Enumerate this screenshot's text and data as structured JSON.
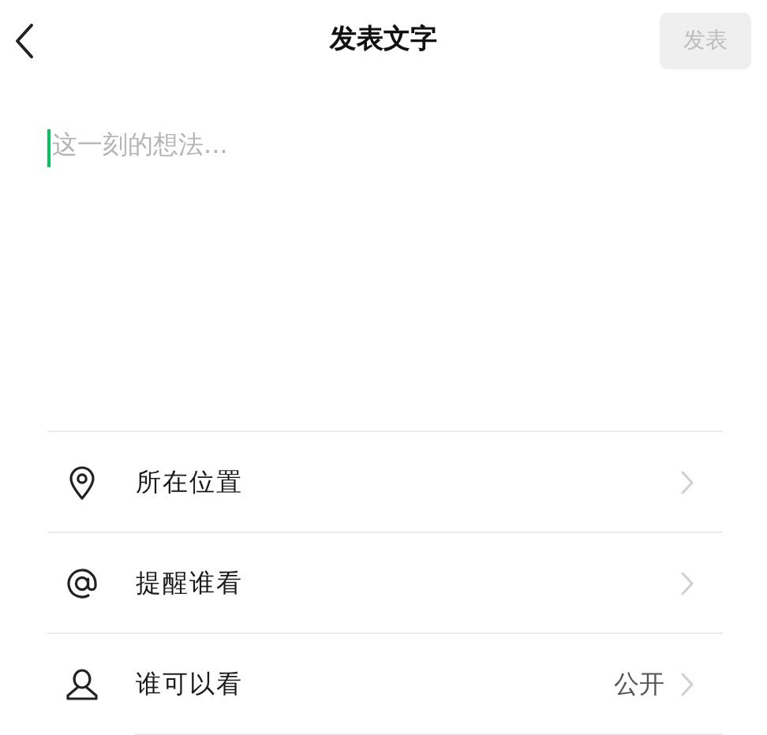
{
  "header": {
    "title": "发表文字",
    "post_button": {
      "label": "发表",
      "disabled": true
    }
  },
  "composer": {
    "placeholder": "这一刻的想法...",
    "focused": true
  },
  "options": [
    {
      "kind": "location",
      "label": "所在位置"
    },
    {
      "kind": "mention",
      "label": "提醒谁看"
    },
    {
      "kind": "visibility",
      "label": "谁可以看",
      "value": "公开"
    }
  ]
}
